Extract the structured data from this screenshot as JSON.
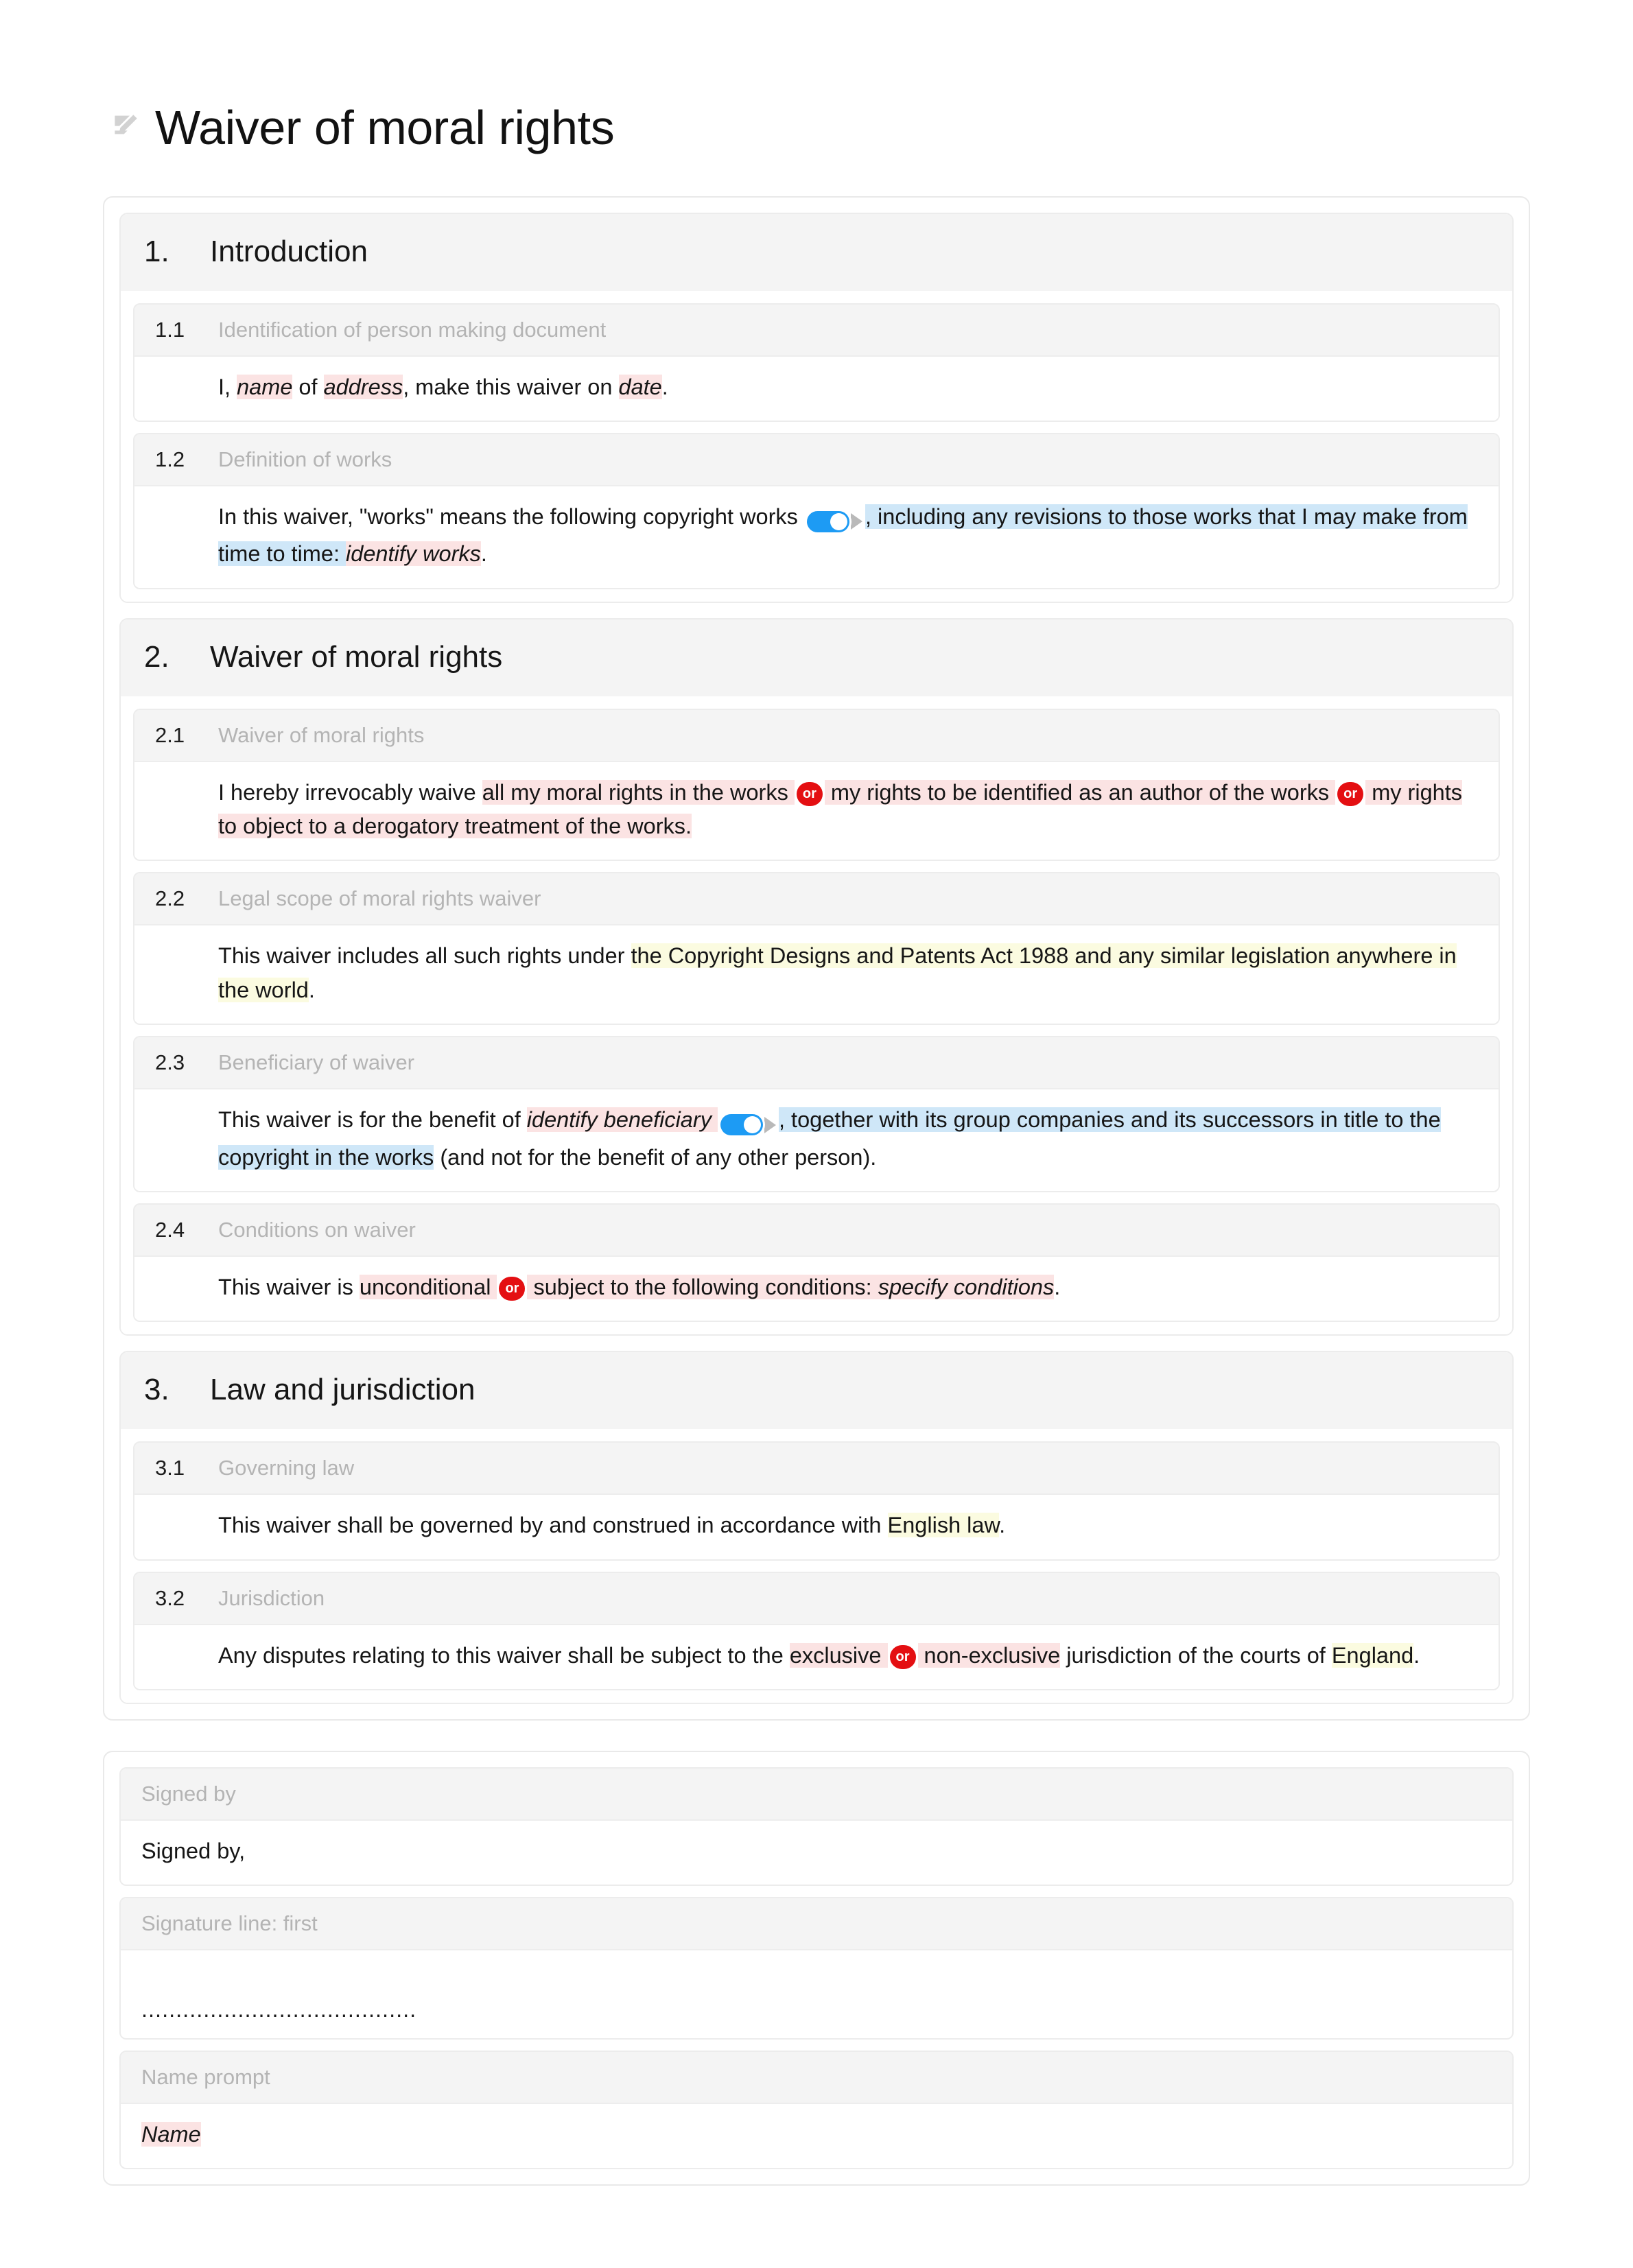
{
  "document": {
    "icon": "document-edit-icon",
    "title": "Waiver of moral rights"
  },
  "colors": {
    "placeholder_highlight": "#fbe3e3",
    "placeholder_highlight_strong": "#f9d4d4",
    "optional_highlight": "#cfe7f8",
    "note_highlight": "#fbfbe0",
    "or_badge": "#e40f12",
    "toggle_on": "#1d9bf4",
    "card_border": "#ececec",
    "header_background": "#f4f4f4",
    "label_text": "#b4b4b4"
  },
  "sections": [
    {
      "number": "1.",
      "title": "Introduction",
      "clauses": [
        {
          "number": "1.1",
          "label": "Identification of person making document",
          "segments": [
            {
              "text": "I, ",
              "style": "plain"
            },
            {
              "text": "name",
              "style": "placeholder"
            },
            {
              "text": " of ",
              "style": "plain"
            },
            {
              "text": "address",
              "style": "placeholder"
            },
            {
              "text": ", make this waiver on ",
              "style": "plain"
            },
            {
              "text": "date",
              "style": "placeholder"
            },
            {
              "text": ".",
              "style": "plain"
            }
          ]
        },
        {
          "number": "1.2",
          "label": "Definition of works",
          "segments": [
            {
              "text": "In this waiver, \"works\" means the following copyright works ",
              "style": "plain"
            },
            {
              "text": "",
              "style": "toggle"
            },
            {
              "text": ", including any revisions to those works that I may make from time to time: ",
              "style": "optional"
            },
            {
              "text": "identify works",
              "style": "placeholder"
            },
            {
              "text": ".",
              "style": "plain"
            }
          ]
        }
      ]
    },
    {
      "number": "2.",
      "title": "Waiver of moral rights",
      "clauses": [
        {
          "number": "2.1",
          "label": "Waiver of moral rights",
          "segments": [
            {
              "text": "I hereby irrevocably waive ",
              "style": "plain"
            },
            {
              "text": "all my moral rights in the works ",
              "style": "placeholder-plain"
            },
            {
              "text": "or",
              "style": "or"
            },
            {
              "text": " my rights to be identified as an author of the works ",
              "style": "placeholder-plain"
            },
            {
              "text": "or",
              "style": "or"
            },
            {
              "text": " my rights to object to a derogatory treatment of the works.",
              "style": "placeholder-plain"
            }
          ]
        },
        {
          "number": "2.2",
          "label": "Legal scope of moral rights waiver",
          "segments": [
            {
              "text": "This waiver includes all such rights under ",
              "style": "plain"
            },
            {
              "text": "the Copyright Designs and Patents Act 1988 and any similar legislation anywhere in the world",
              "style": "note"
            },
            {
              "text": ".",
              "style": "plain"
            }
          ]
        },
        {
          "number": "2.3",
          "label": "Beneficiary of waiver",
          "segments": [
            {
              "text": "This waiver is for the benefit of ",
              "style": "plain"
            },
            {
              "text": "identify beneficiary ",
              "style": "placeholder"
            },
            {
              "text": "",
              "style": "toggle"
            },
            {
              "text": ", together with its group companies and its successors in title to the copyright in the works",
              "style": "optional"
            },
            {
              "text": " (and not for the benefit of any other person).",
              "style": "plain"
            }
          ]
        },
        {
          "number": "2.4",
          "label": "Conditions on waiver",
          "segments": [
            {
              "text": "This waiver is ",
              "style": "plain"
            },
            {
              "text": "unconditional ",
              "style": "placeholder-plain"
            },
            {
              "text": "or",
              "style": "or"
            },
            {
              "text": " subject to the following conditions: ",
              "style": "placeholder-plain"
            },
            {
              "text": "specify conditions",
              "style": "placeholder-strong"
            },
            {
              "text": ".",
              "style": "plain"
            }
          ]
        }
      ]
    },
    {
      "number": "3.",
      "title": "Law and jurisdiction",
      "clauses": [
        {
          "number": "3.1",
          "label": "Governing law",
          "segments": [
            {
              "text": "This waiver shall be governed by and construed in accordance with ",
              "style": "plain"
            },
            {
              "text": "English law",
              "style": "note"
            },
            {
              "text": ".",
              "style": "plain"
            }
          ]
        },
        {
          "number": "3.2",
          "label": "Jurisdiction",
          "segments": [
            {
              "text": "Any disputes relating to this waiver shall be subject to the ",
              "style": "plain"
            },
            {
              "text": "exclusive ",
              "style": "placeholder-plain"
            },
            {
              "text": "or",
              "style": "or"
            },
            {
              "text": " non-exclusive",
              "style": "placeholder-plain"
            },
            {
              "text": " jurisdiction of the courts of ",
              "style": "plain"
            },
            {
              "text": "England",
              "style": "note"
            },
            {
              "text": ".",
              "style": "plain"
            }
          ]
        }
      ]
    }
  ],
  "signature_block": {
    "clauses": [
      {
        "label": "Signed by",
        "variant": "text",
        "segments": [
          {
            "text": "Signed by,",
            "style": "plain"
          }
        ]
      },
      {
        "label": "Signature line: first",
        "variant": "signature-line",
        "line": "........................................"
      },
      {
        "label": "Name prompt",
        "variant": "text",
        "segments": [
          {
            "text": "Name",
            "style": "placeholder"
          }
        ]
      }
    ]
  }
}
